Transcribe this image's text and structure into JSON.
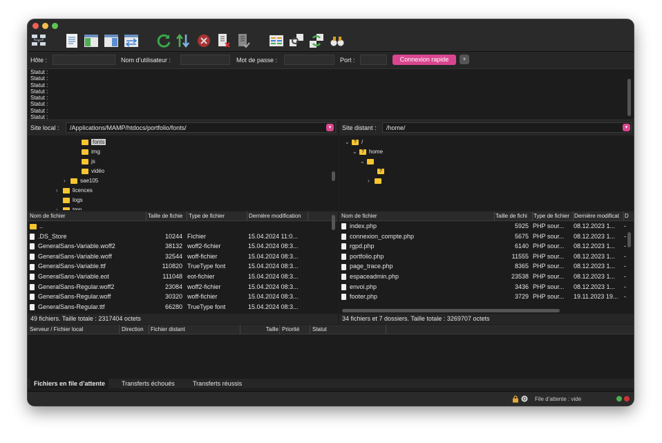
{
  "quickconnect": {
    "host_label": "Hôte :",
    "user_label": "Nom d’utilisateur :",
    "pass_label": "Mot de passe :",
    "port_label": "Port :",
    "connect_label": "Connexion rapide",
    "host_value": "",
    "user_value": "",
    "pass_value": "",
    "port_value": ""
  },
  "log": {
    "lines": [
      "Statut :",
      "Statut :",
      "Statut :",
      "Statut :",
      "Statut :",
      "Statut :",
      "Statut :",
      "Statut :"
    ]
  },
  "local": {
    "label": "Site local :",
    "path": "/Applications/MAMP/htdocs/portfolio/fonts/",
    "tree": [
      {
        "name": "fonts",
        "selected": true
      },
      {
        "name": "img"
      },
      {
        "name": "js"
      },
      {
        "name": "vidéo"
      },
      {
        "name": "sae105"
      },
      {
        "name": "licences"
      },
      {
        "name": "logs"
      },
      {
        "name": "tmp"
      }
    ],
    "headers": [
      "Nom de fichier",
      "Taille de fichie",
      "Type de fichier",
      "Dernière modification"
    ],
    "files": [
      {
        "name": "..",
        "size": "",
        "type": "",
        "date": ""
      },
      {
        "name": ".DS_Store",
        "size": "10244",
        "type": "Fichier",
        "date": "15.04.2024 11:0..."
      },
      {
        "name": "GeneralSans-Variable.woff2",
        "size": "38132",
        "type": "woff2-fichier",
        "date": "15.04.2024 08:3..."
      },
      {
        "name": "GeneralSans-Variable.woff",
        "size": "32544",
        "type": "woff-fichier",
        "date": "15.04.2024 08:3..."
      },
      {
        "name": "GeneralSans-Variable.ttf",
        "size": "110820",
        "type": "TrueType font",
        "date": "15.04.2024 08:3..."
      },
      {
        "name": "GeneralSans-Variable.eot",
        "size": "111048",
        "type": "eot-fichier",
        "date": "15.04.2024 08:3..."
      },
      {
        "name": "GeneralSans-Regular.woff2",
        "size": "23084",
        "type": "woff2-fichier",
        "date": "15.04.2024 08:3..."
      },
      {
        "name": "GeneralSans-Regular.woff",
        "size": "30320",
        "type": "woff-fichier",
        "date": "15.04.2024 08:3..."
      },
      {
        "name": "GeneralSans-Regular.ttf",
        "size": "66280",
        "type": "TrueType font",
        "date": "15.04.2024 08:3..."
      }
    ],
    "status": "49 fichiers. Taille totale : 2317404 octets"
  },
  "remote": {
    "label": "Site distant :",
    "path": "/home/",
    "tree": [
      {
        "name": "/"
      },
      {
        "name": "home"
      }
    ],
    "headers": [
      "Nom de fichier",
      "Taille de fichi",
      "Type de fichier",
      "Dernière modificat",
      "D"
    ],
    "files": [
      {
        "name": "index.php",
        "size": "5925",
        "type": "PHP sour...",
        "date": "08.12.2023 1...",
        "perm": "-"
      },
      {
        "name": "connexion_compte.php",
        "size": "5675",
        "type": "PHP sour...",
        "date": "08.12.2023 1...",
        "perm": "-"
      },
      {
        "name": "rgpd.php",
        "size": "6140",
        "type": "PHP sour...",
        "date": "08.12.2023 1...",
        "perm": "-"
      },
      {
        "name": "portfolio.php",
        "size": "11555",
        "type": "PHP sour...",
        "date": "08.12.2023 1...",
        "perm": "-"
      },
      {
        "name": "page_trace.php",
        "size": "8365",
        "type": "PHP sour...",
        "date": "08.12.2023 1...",
        "perm": "-"
      },
      {
        "name": "espaceadmin.php",
        "size": "23538",
        "type": "PHP sour...",
        "date": "08.12.2023 1...",
        "perm": "-"
      },
      {
        "name": "envoi.php",
        "size": "3436",
        "type": "PHP sour...",
        "date": "08.12.2023 1...",
        "perm": "-"
      },
      {
        "name": "footer.php",
        "size": "3729",
        "type": "PHP sour...",
        "date": "19.11.2023 19...",
        "perm": "-"
      }
    ],
    "status": "34 fichiers et 7 dossiers. Taille totale : 3269707 octets"
  },
  "queue": {
    "headers": [
      "Serveur / Fichier local",
      "Direction",
      "Fichier distant",
      "Taille",
      "Priorité",
      "Statut"
    ]
  },
  "tabs": [
    "Fichiers en file d’attente",
    "Transferts échoués",
    "Transferts réussis"
  ],
  "footer": {
    "queue_status": "File d’attente : vide"
  },
  "colors": {
    "accent": "#d9468f",
    "folder": "#f7c531",
    "background": "#1e1e1e"
  },
  "toolbar_icons": [
    "site-manager-icon",
    "message-log-icon",
    "local-tree-icon",
    "remote-tree-icon",
    "transfer-queue-icon",
    "refresh-icon",
    "process-queue-icon",
    "cancel-icon",
    "disconnect-icon",
    "reconnect-icon",
    "directory-comparison-icon",
    "sync-browsing-icon",
    "search-remote-icon",
    "find-files-icon"
  ]
}
